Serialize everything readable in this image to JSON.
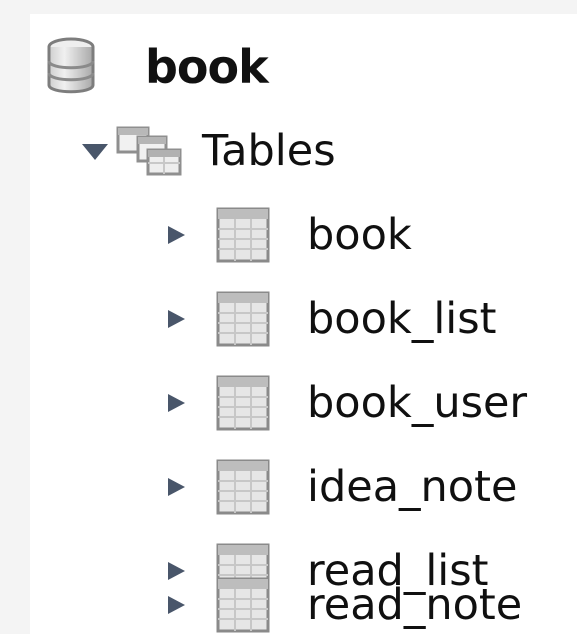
{
  "tree": {
    "database": {
      "name": "book",
      "icon": "database-icon"
    },
    "tables_node": {
      "label": "Tables",
      "expanded": true,
      "icon": "tables-folder-icon"
    },
    "tables": [
      {
        "name": "book",
        "expanded": false,
        "icon": "table-icon"
      },
      {
        "name": "book_list",
        "expanded": false,
        "icon": "table-icon"
      },
      {
        "name": "book_user",
        "expanded": false,
        "icon": "table-icon"
      },
      {
        "name": "idea_note",
        "expanded": false,
        "icon": "table-icon"
      },
      {
        "name": "read_list",
        "expanded": false,
        "icon": "table-icon"
      },
      {
        "name": "read_note",
        "expanded": false,
        "icon": "table-icon"
      }
    ]
  },
  "colors": {
    "arrow": "#49566a",
    "icon_border": "#8a8a8a",
    "icon_fill": "#e5e5e5"
  }
}
